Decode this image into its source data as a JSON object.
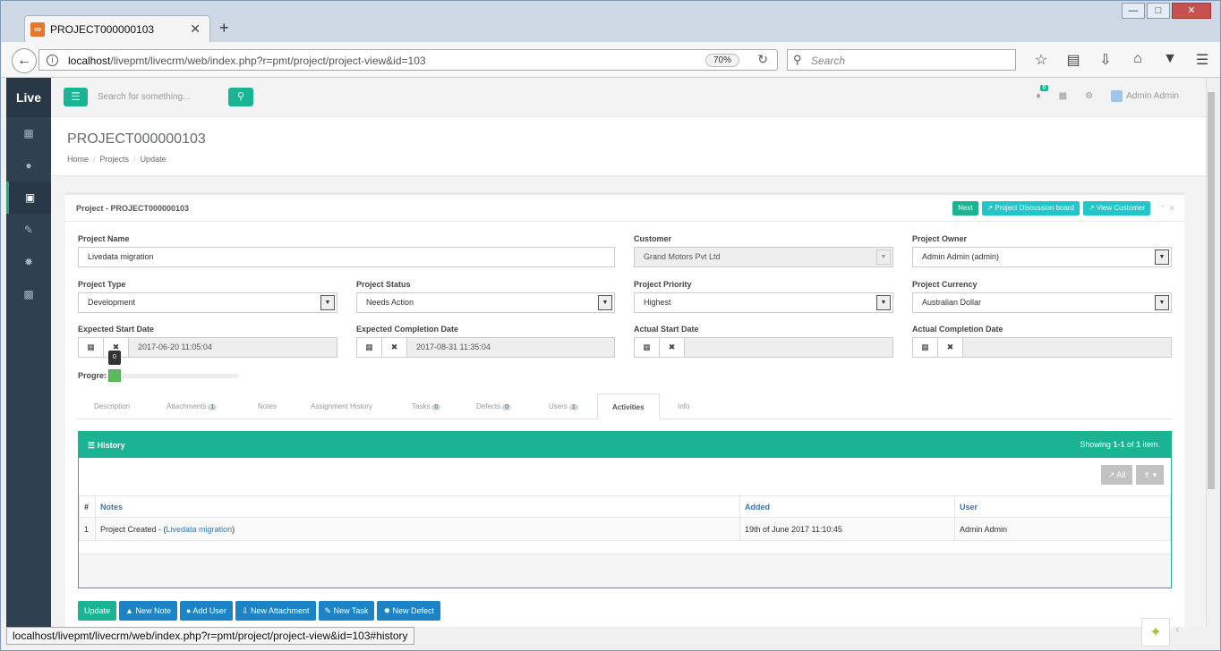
{
  "browser": {
    "tab_title": "PROJECT000000103",
    "url_host": "localhost",
    "url_path": "/livepmt/livecrm/web/index.php?r=pmt/project/project-view&id=103",
    "zoom": "70%",
    "search_placeholder": "Search",
    "status_url": "localhost/livepmt/livecrm/web/index.php?r=pmt/project/project-view&id=103#history"
  },
  "sidebar": {
    "brand": "Live"
  },
  "topbar": {
    "search_placeholder": "Search for something...",
    "notif_count": "0",
    "user": "Admin Admin"
  },
  "page": {
    "title": "PROJECT000000103",
    "breadcrumb": [
      "Home",
      "Projects",
      "Update"
    ]
  },
  "box": {
    "title": "Project - PROJECT000000103",
    "btn_next": "Next",
    "btn_discussion": "Project Discussion board",
    "btn_customer": "View Customer"
  },
  "form": {
    "project_name_label": "Project Name",
    "project_name": "Livedata migration",
    "customer_label": "Customer",
    "customer": "Grand Motors Pvt Ltd",
    "owner_label": "Project Owner",
    "owner": "Admin Admin (admin)",
    "type_label": "Project Type",
    "type": "Development",
    "status_label": "Project Status",
    "status": "Needs Action",
    "priority_label": "Project Priority",
    "priority": "Highest",
    "currency_label": "Project Currency",
    "currency": "Australian Dollar",
    "exp_start_label": "Expected Start Date",
    "exp_start": "2017-06-20 11:05:04",
    "exp_end_label": "Expected Completion Date",
    "exp_end": "2017-08-31 11:35:04",
    "act_start_label": "Actual Start Date",
    "act_start": "",
    "act_end_label": "Actual Completion Date",
    "act_end": "",
    "progress_label": "Progres",
    "progress": "0"
  },
  "tabs": [
    {
      "label": "Description",
      "count": ""
    },
    {
      "label": "Attachments",
      "count": "1"
    },
    {
      "label": "Notes",
      "count": ""
    },
    {
      "label": "Assignment History",
      "count": ""
    },
    {
      "label": "Tasks",
      "count": "0"
    },
    {
      "label": "Defects",
      "count": "0"
    },
    {
      "label": "Users",
      "count": "1"
    },
    {
      "label": "Activities",
      "count": ""
    },
    {
      "label": "Info",
      "count": ""
    }
  ],
  "history": {
    "title": "History",
    "summary_pre": "Showing ",
    "summary_range": "1-1",
    "summary_mid": " of ",
    "summary_total": "1",
    "summary_post": " item.",
    "btn_all": "All",
    "columns": [
      "#",
      "Notes",
      "Added",
      "User"
    ],
    "row": {
      "num": "1",
      "note_prefix": "Project Created - (",
      "note_link": "Livedata migration",
      "note_suffix": ")",
      "added": "19th of June 2017 11:10:45",
      "user": "Admin Admin"
    }
  },
  "actions": [
    "Update",
    "New Note",
    "Add User",
    "New Attachment",
    "New Task",
    "New Defect"
  ],
  "colors": {
    "accent": "#1ab394",
    "info": "#23c6c8",
    "primary": "#1c84c6",
    "sidebar": "#2f4050"
  }
}
